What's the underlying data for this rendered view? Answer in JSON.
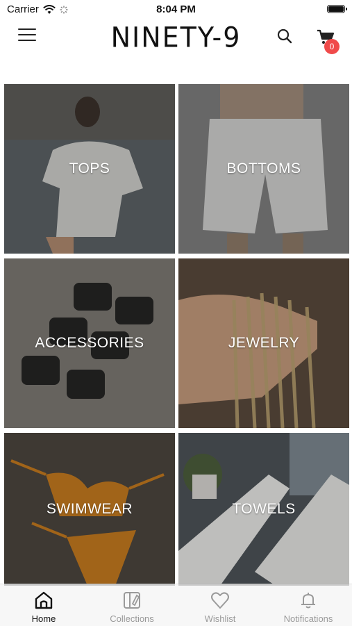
{
  "status_bar": {
    "carrier": "Carrier",
    "time": "8:04 PM"
  },
  "header": {
    "logo": "NINETY-9",
    "cart_count": "0"
  },
  "categories": [
    {
      "label": "TOPS"
    },
    {
      "label": "BOTTOMS"
    },
    {
      "label": "ACCESSORIES"
    },
    {
      "label": "JEWELRY"
    },
    {
      "label": "SWIMWEAR"
    },
    {
      "label": "TOWELS"
    }
  ],
  "tabbar": {
    "items": [
      {
        "label": "Home",
        "icon": "home-icon",
        "active": true
      },
      {
        "label": "Collections",
        "icon": "collections-icon",
        "active": false
      },
      {
        "label": "Wishlist",
        "icon": "heart-icon",
        "active": false
      },
      {
        "label": "Notifications",
        "icon": "bell-icon",
        "active": false
      }
    ]
  },
  "colors": {
    "badge": "#f04a4a",
    "active_tab": "#111111",
    "inactive_tab": "#9a9a9a"
  }
}
